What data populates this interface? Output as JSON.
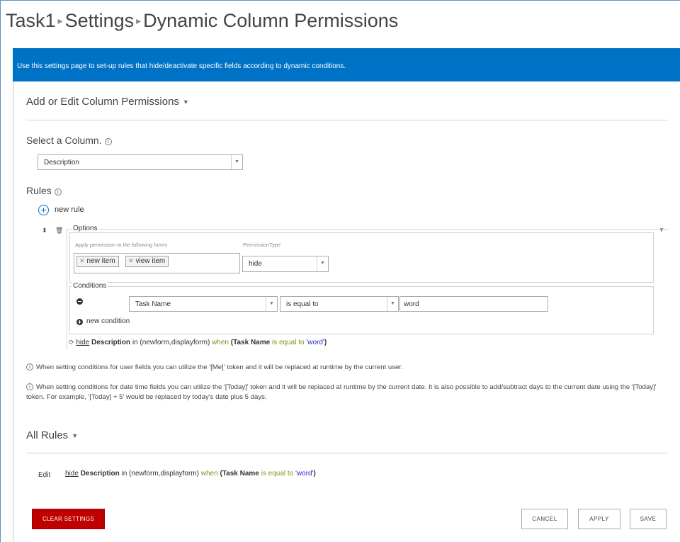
{
  "breadcrumb": {
    "items": [
      "Task1",
      "Settings",
      "Dynamic Column Permissions"
    ],
    "separator": "▸"
  },
  "banner": {
    "text": "Use this settings page to set-up rules that hide/deactivate specific fields according to dynamic conditions."
  },
  "sections": {
    "add_edit": "Add or Edit Column Permissions",
    "select_column": "Select a Column.",
    "rules": "Rules",
    "all_rules": "All Rules"
  },
  "column_select": {
    "value": "Description"
  },
  "new_rule_label": "new rule",
  "options": {
    "legend": "Options",
    "forms_label": "Apply permission to the following forms",
    "forms": [
      "new item",
      "view item"
    ],
    "permission_type_label": "PermissionType",
    "permission_type_value": "hide"
  },
  "conditions": {
    "legend": "Conditions",
    "rows": [
      {
        "field": "Task Name",
        "operator": "is equal to",
        "value": "word"
      }
    ],
    "new_condition_label": "new condition"
  },
  "rule_summary": {
    "action": "hide",
    "column": "Description",
    "in_text": "in (newform,displayform)",
    "when": "when",
    "open": "(",
    "field": "Task Name",
    "op": "is equal to",
    "value": "'word'",
    "close": ")"
  },
  "notes": [
    "When setting conditions for user fields you can utilize the '[Me]' token and it will be replaced at runtime by the current user.",
    "When setting conditions for date time fields you can utilize the '[Today]' token and it will be replaced at runtime by the current date. It is also possible to add/subtract days to the current date using the '[Today]' token. For example, '[Today] + 5' would be replaced by today's date plus 5 days."
  ],
  "all_rules": {
    "edit_label": "Edit"
  },
  "buttons": {
    "clear": "CLEAR SETTINGS",
    "cancel": "CANCEL",
    "apply": "APPLY",
    "save": "SAVE"
  },
  "colors": {
    "banner": "#0072c6",
    "clear_button": "#c00000",
    "link": "#0072c6"
  }
}
